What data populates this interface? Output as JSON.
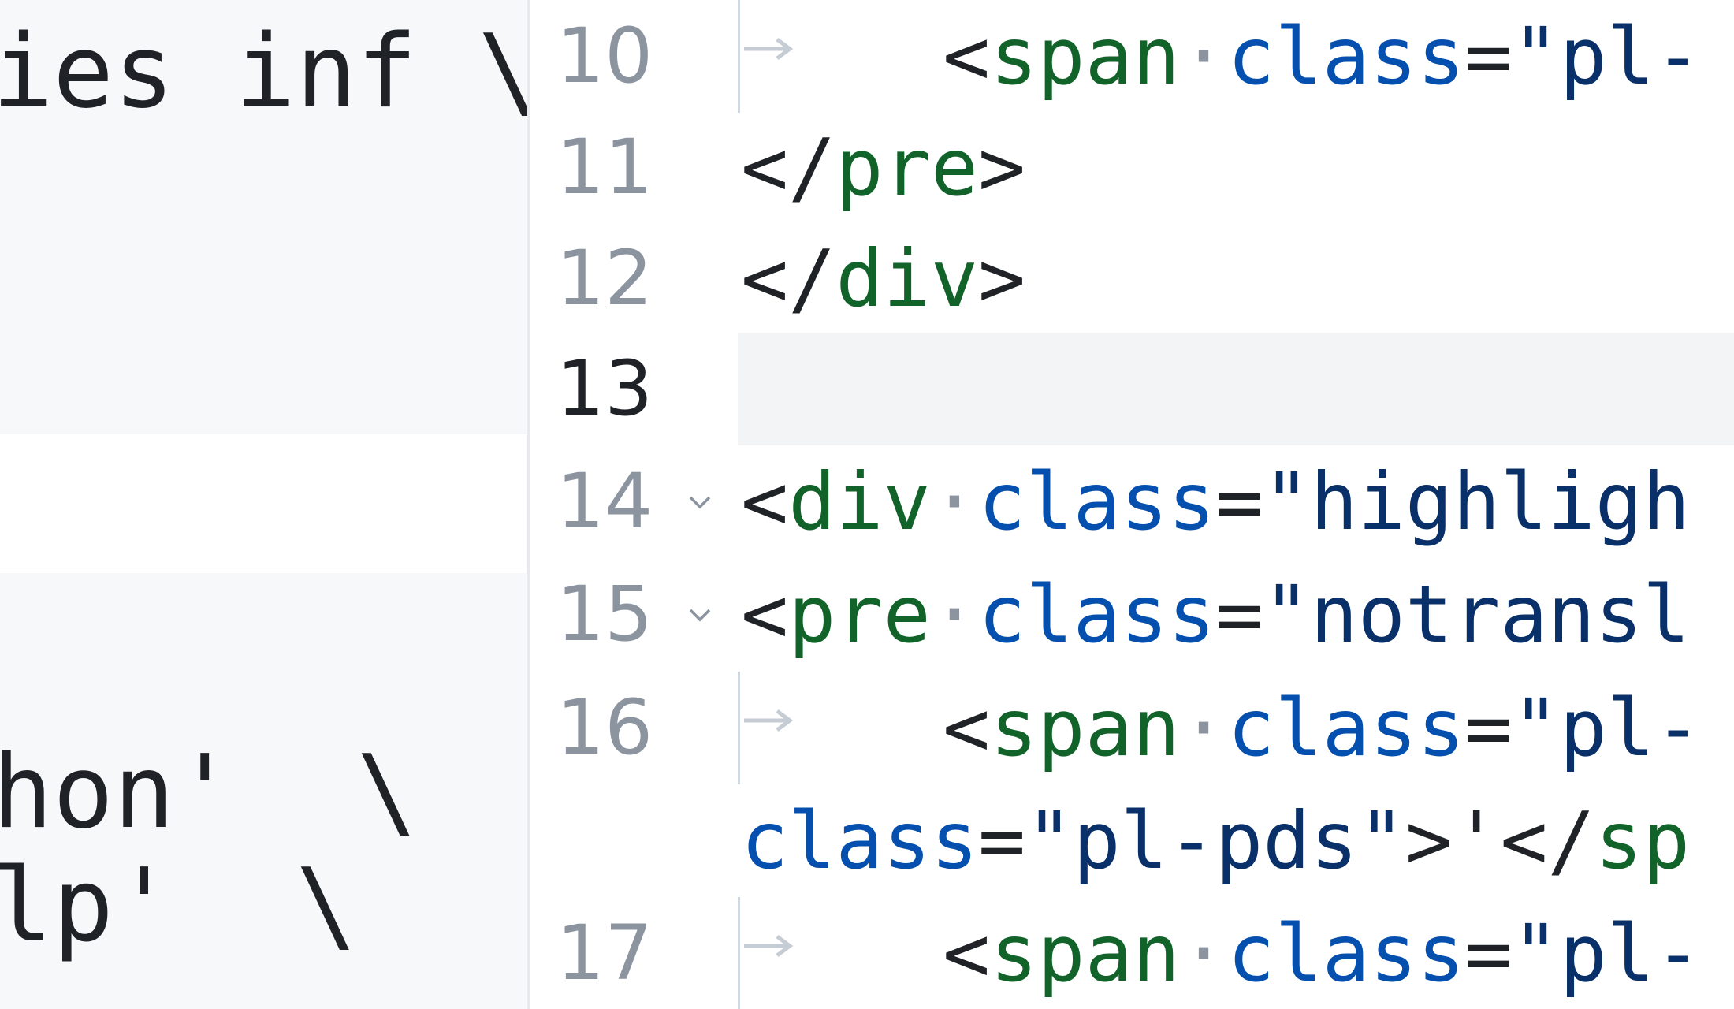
{
  "left_pane": {
    "lines": [
      "ies inf \\",
      "hon'  \\",
      "lp'  \\"
    ]
  },
  "editor": {
    "rows": [
      {
        "number": "10",
        "indent": true,
        "parts": [
          "<",
          "span",
          "·",
          "class",
          "=",
          "\"pl-"
        ]
      },
      {
        "number": "11",
        "indent": false,
        "parts": [
          "</",
          "pre",
          ">"
        ]
      },
      {
        "number": "12",
        "indent": false,
        "parts": [
          "</",
          "div",
          ">"
        ]
      },
      {
        "number": "13",
        "indent": false,
        "active": true
      },
      {
        "number": "14",
        "fold": true,
        "parts": [
          "<",
          "div",
          "·",
          "class",
          "=",
          "\"highligh"
        ]
      },
      {
        "number": "15",
        "fold": true,
        "parts": [
          "<",
          "pre",
          "·",
          "class",
          "=",
          "\"notransl"
        ]
      },
      {
        "number": "16",
        "indent": true,
        "parts": [
          "<",
          "span",
          "·",
          "class",
          "=",
          "\"pl-"
        ]
      },
      {
        "number": "",
        "wrap": true,
        "parts": [
          "class",
          "=",
          "\"pl-pds\"",
          ">'",
          "</",
          "sp"
        ]
      },
      {
        "number": "17",
        "indent": true,
        "parts": [
          "<",
          "span",
          "·",
          "class",
          "=",
          "\"pl-"
        ]
      }
    ]
  },
  "colors": {
    "tag": "#116329",
    "attribute": "#0550ae",
    "string": "#0a3069",
    "line_number": "#8c959f",
    "active_line_number": "#1f2328",
    "active_line_bg": "#f2f4f6",
    "left_pane_bg": "#f6f8fa"
  },
  "icons": {
    "fold": "chevron-down-icon",
    "tab": "tab-arrow-icon"
  }
}
